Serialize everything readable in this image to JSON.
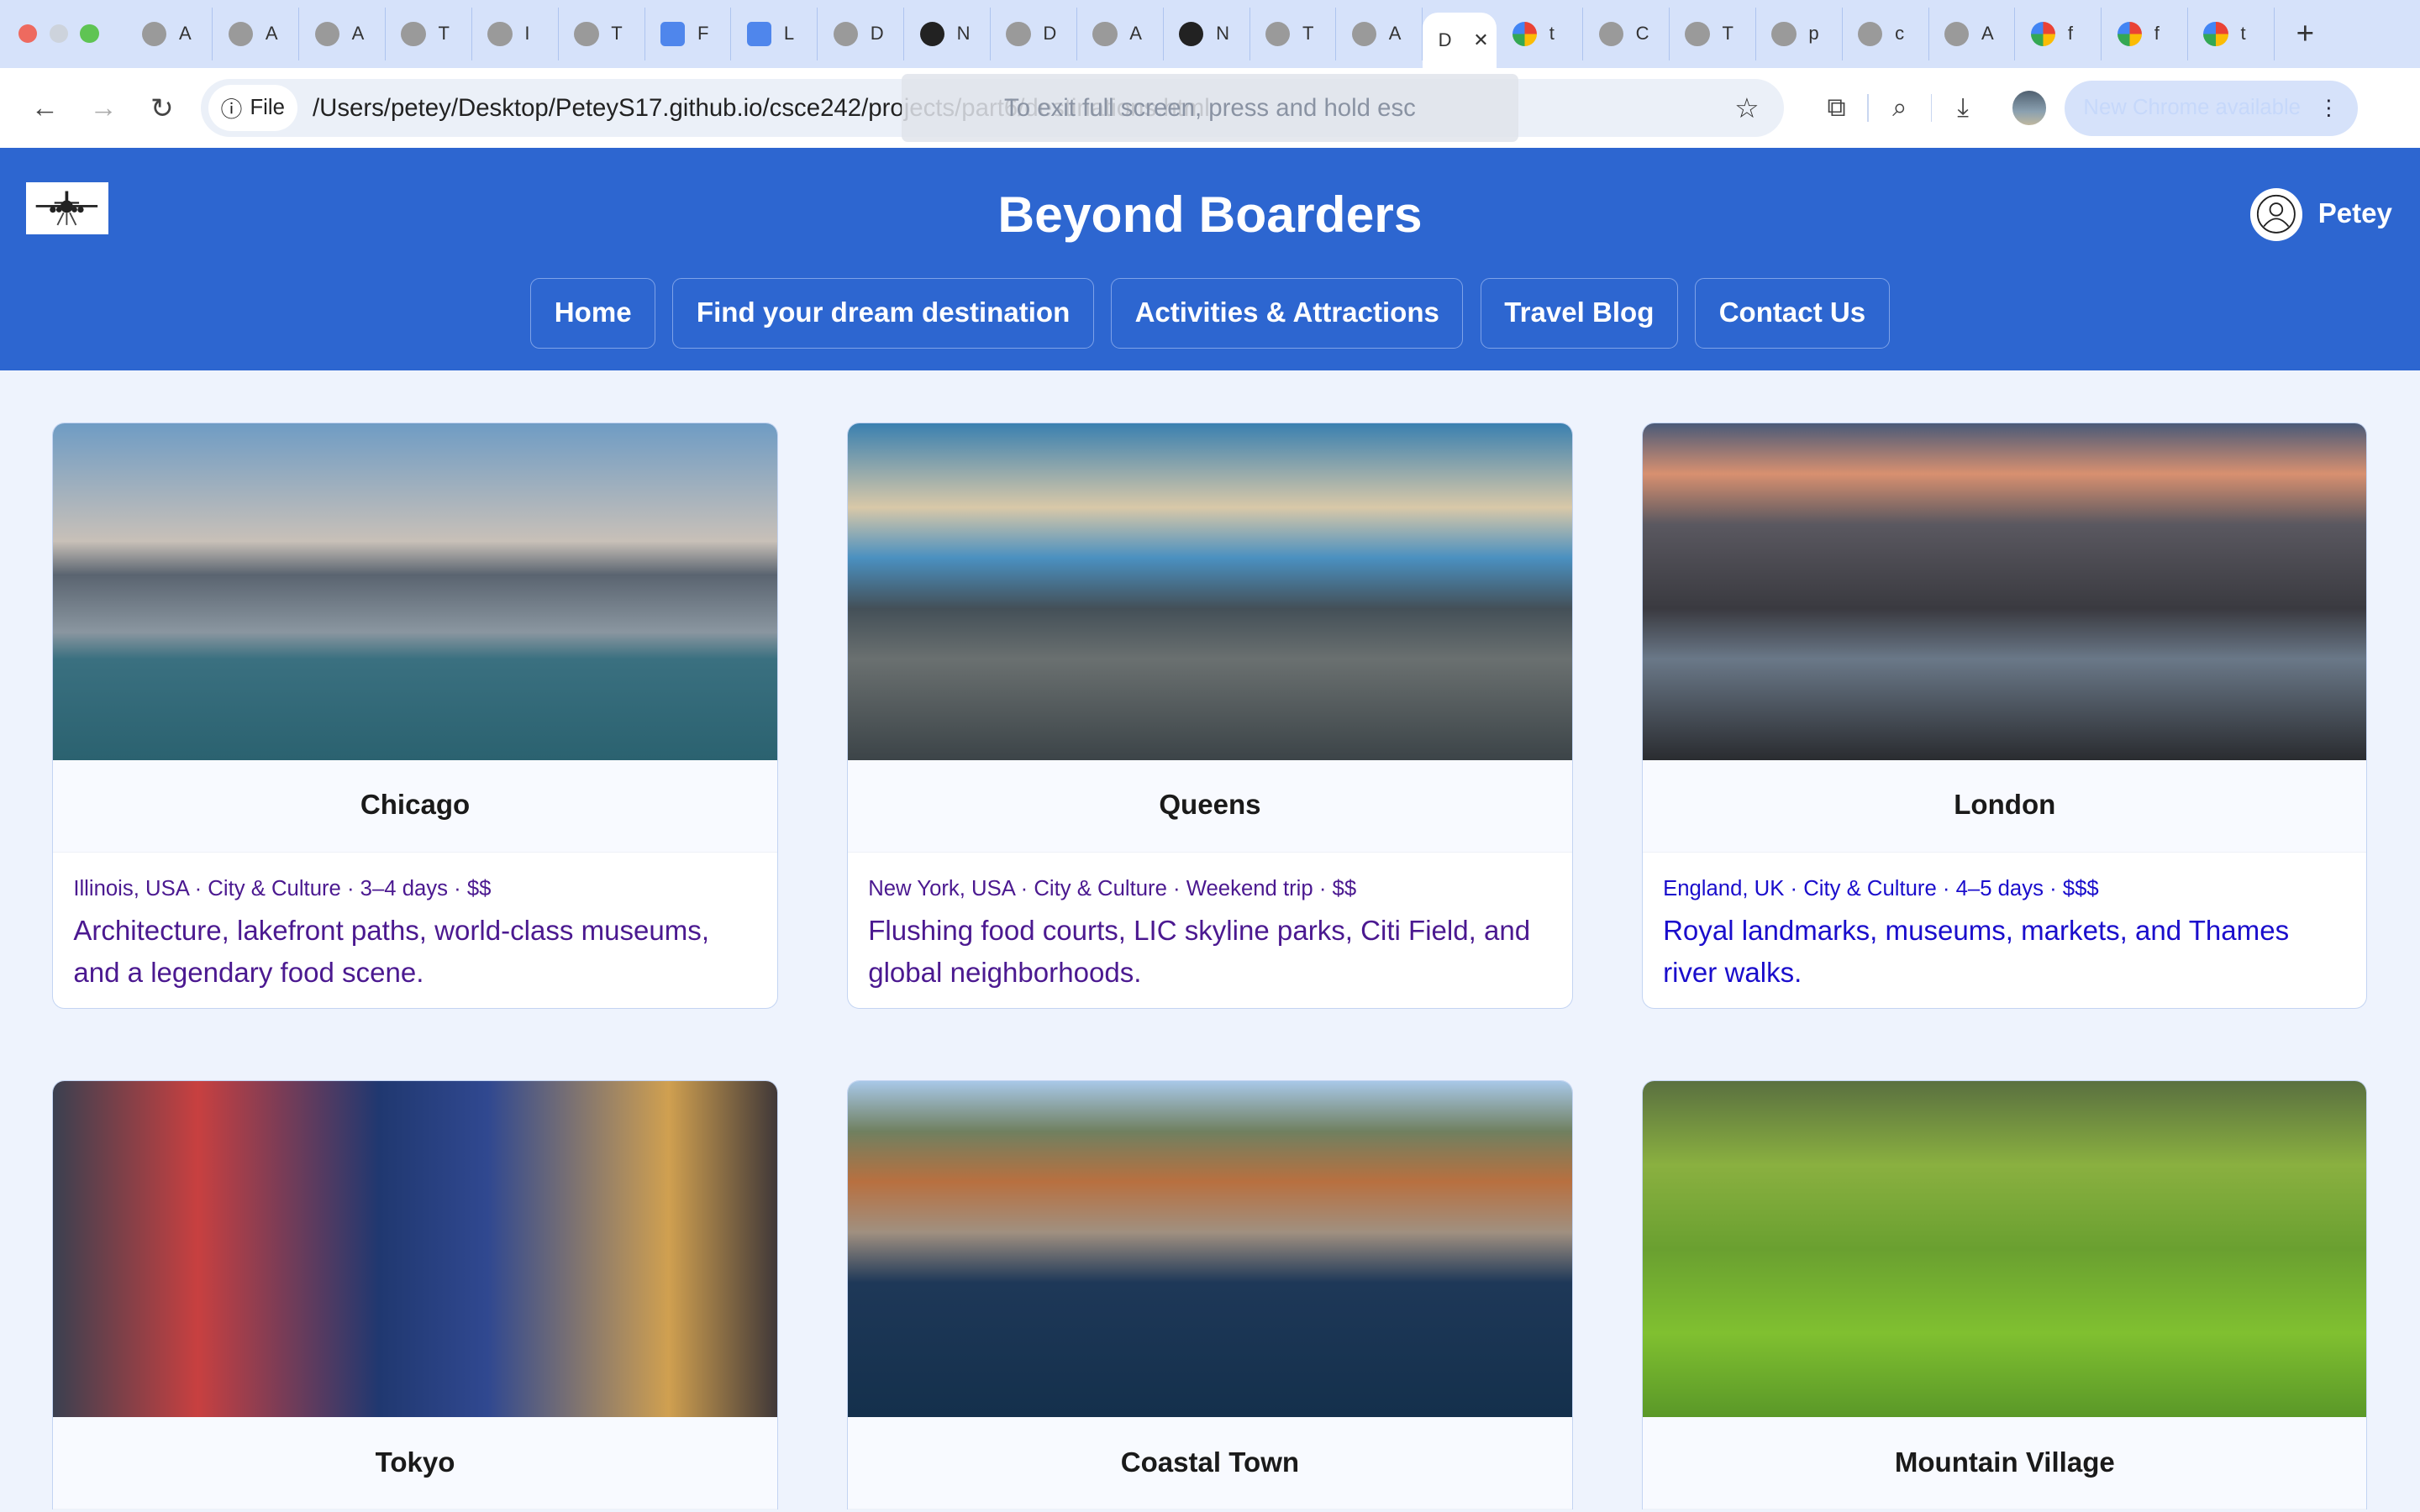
{
  "browser": {
    "tabs": [
      {
        "icon": "globe",
        "letter": "A"
      },
      {
        "icon": "globe",
        "letter": "A"
      },
      {
        "icon": "globe",
        "letter": "A"
      },
      {
        "icon": "globe",
        "letter": "T"
      },
      {
        "icon": "globe",
        "letter": "I"
      },
      {
        "icon": "globe",
        "letter": "T"
      },
      {
        "icon": "doc",
        "letter": "F"
      },
      {
        "icon": "doc",
        "letter": "L"
      },
      {
        "icon": "globe",
        "letter": "D"
      },
      {
        "icon": "github",
        "letter": "N"
      },
      {
        "icon": "globe",
        "letter": "D"
      },
      {
        "icon": "globe",
        "letter": "A"
      },
      {
        "icon": "github",
        "letter": "N"
      },
      {
        "icon": "globe",
        "letter": "T"
      },
      {
        "icon": "globe",
        "letter": "A"
      },
      {
        "icon": "none",
        "letter": "D",
        "active": true,
        "close": "✕"
      },
      {
        "icon": "google",
        "letter": "t"
      },
      {
        "icon": "globe",
        "letter": "C"
      },
      {
        "icon": "globe",
        "letter": "T"
      },
      {
        "icon": "globe",
        "letter": "p"
      },
      {
        "icon": "globe",
        "letter": "c"
      },
      {
        "icon": "globe",
        "letter": "A"
      },
      {
        "icon": "google",
        "letter": "f"
      },
      {
        "icon": "google",
        "letter": "f"
      },
      {
        "icon": "google",
        "letter": "t"
      }
    ],
    "new_tab": "+",
    "chip_label": "File",
    "url": "/Users/petey/Desktop/PeteyS17.github.io/csce242/projects/part6/destinations.html",
    "fullscreen_hint": "To exit full screen, press and hold esc",
    "update_label": "New Chrome available",
    "menu": "⋮"
  },
  "site": {
    "title": "Beyond Boarders",
    "user": "Petey",
    "nav": [
      "Home",
      "Find your dream destination",
      "Activities & Attractions",
      "Travel Blog",
      "Contact Us"
    ]
  },
  "cards": [
    {
      "name": "Chicago",
      "meta": "Illinois, USA · City & Culture · 3–4 days · $$",
      "desc": "Architecture, lakefront paths, world-class museums, and a legendary food scene."
    },
    {
      "name": "Queens",
      "meta": "New York, USA · City & Culture · Weekend trip · $$",
      "desc": "Flushing food courts, LIC skyline parks, Citi Field, and global neighborhoods."
    },
    {
      "name": "London",
      "meta": "England, UK · City & Culture · 4–5 days · $$$",
      "desc": "Royal landmarks, museums, markets, and Thames river walks."
    },
    {
      "name": "Tokyo"
    },
    {
      "name": "Coastal Town"
    },
    {
      "name": "Mountain Village"
    }
  ]
}
